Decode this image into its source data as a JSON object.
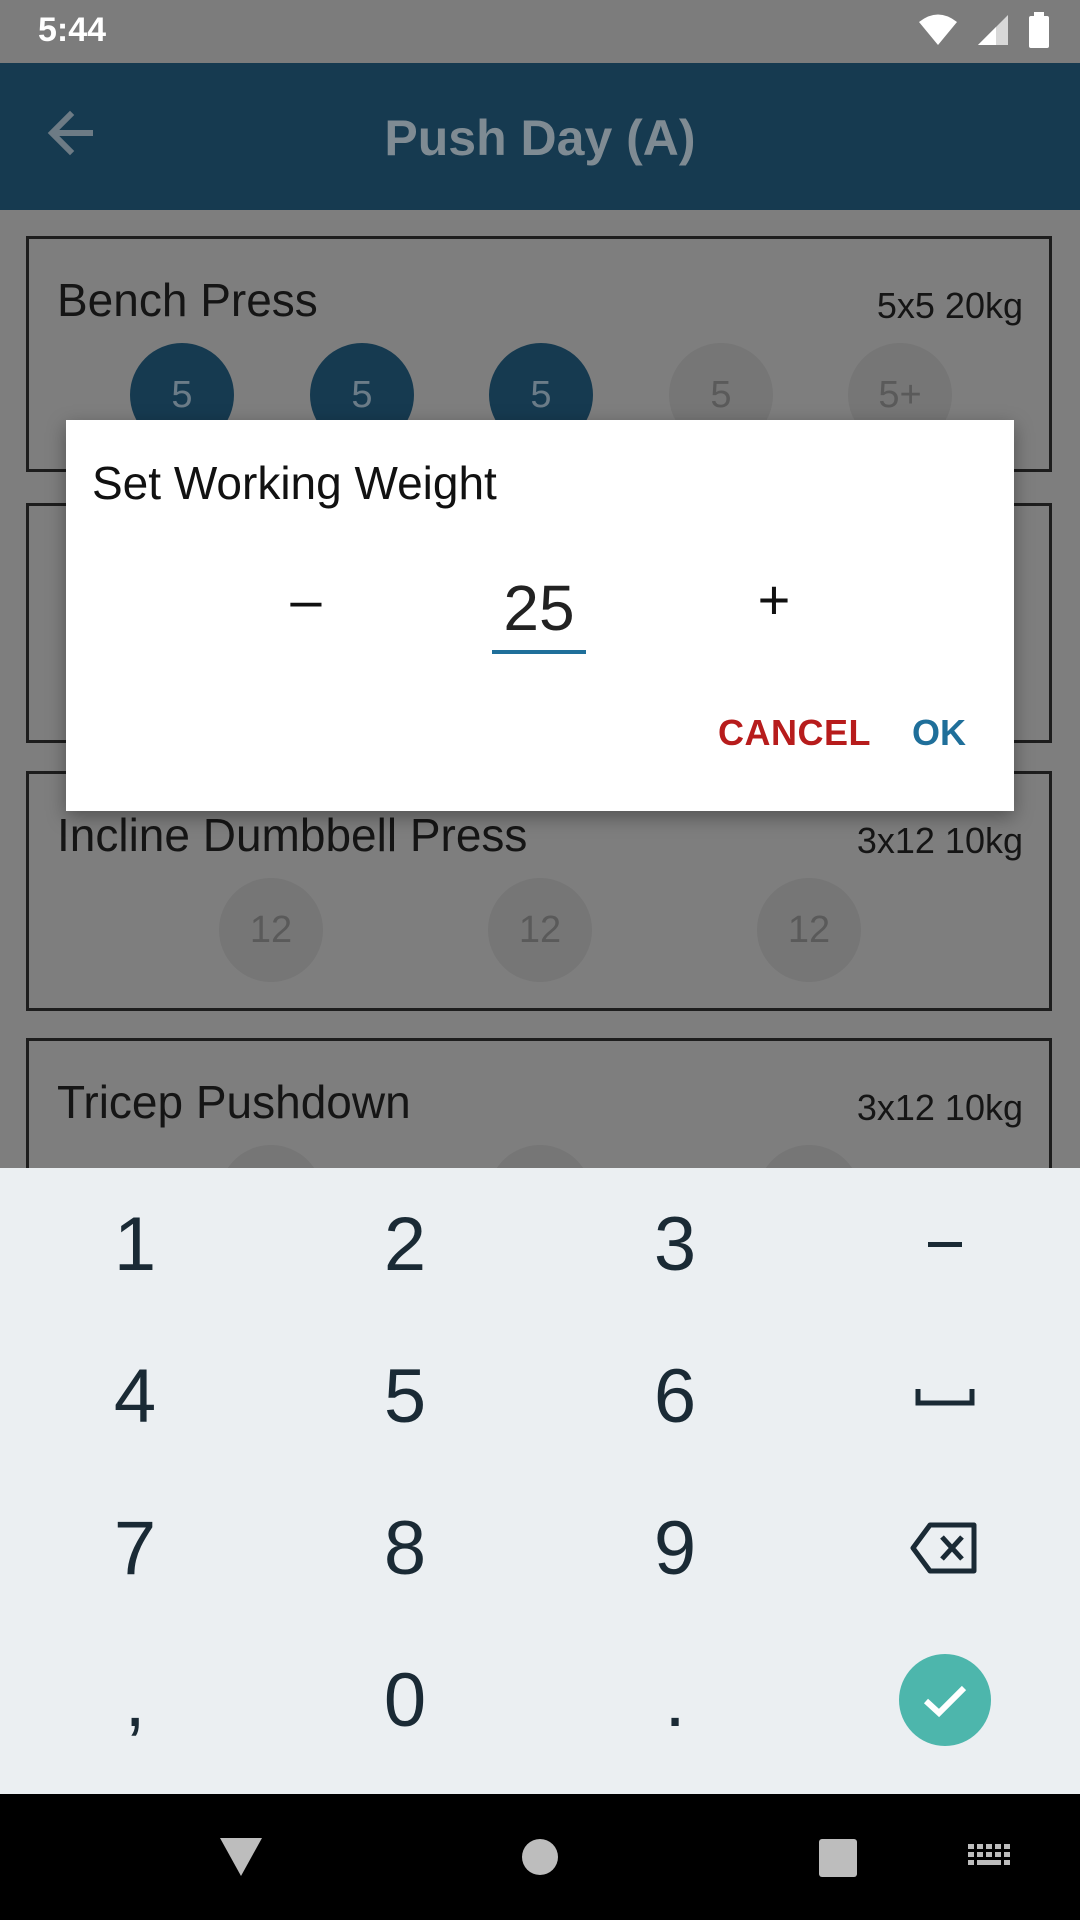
{
  "status_bar": {
    "time": "5:44"
  },
  "app_bar": {
    "title": "Push Day (A)"
  },
  "exercises": [
    {
      "name": "Bench Press",
      "scheme": "5x5 20kg",
      "sets": [
        "5",
        "5",
        "5",
        "5",
        "5+"
      ]
    },
    {
      "name": "",
      "scheme": "",
      "sets": []
    },
    {
      "name": "Incline Dumbbell Press",
      "scheme": "3x12 10kg",
      "sets": [
        "12",
        "12",
        "12"
      ]
    },
    {
      "name": "Tricep Pushdown",
      "scheme": "3x12 10kg",
      "sets": []
    }
  ],
  "dialog": {
    "title": "Set Working Weight",
    "decrement_label": "–",
    "increment_label": "+",
    "value": "25",
    "cancel_label": "CANCEL",
    "ok_label": "OK"
  },
  "keyboard": {
    "keys": [
      "1",
      "2",
      "3",
      "-",
      "4",
      "5",
      "6",
      "␣",
      "7",
      "8",
      "9",
      "⌫",
      ",",
      "0",
      ".",
      "✓"
    ]
  },
  "colors": {
    "app_bar": "#163a50",
    "accent": "#1f6f9a",
    "cancel": "#b71c1c",
    "fab": "#4db6ac"
  }
}
